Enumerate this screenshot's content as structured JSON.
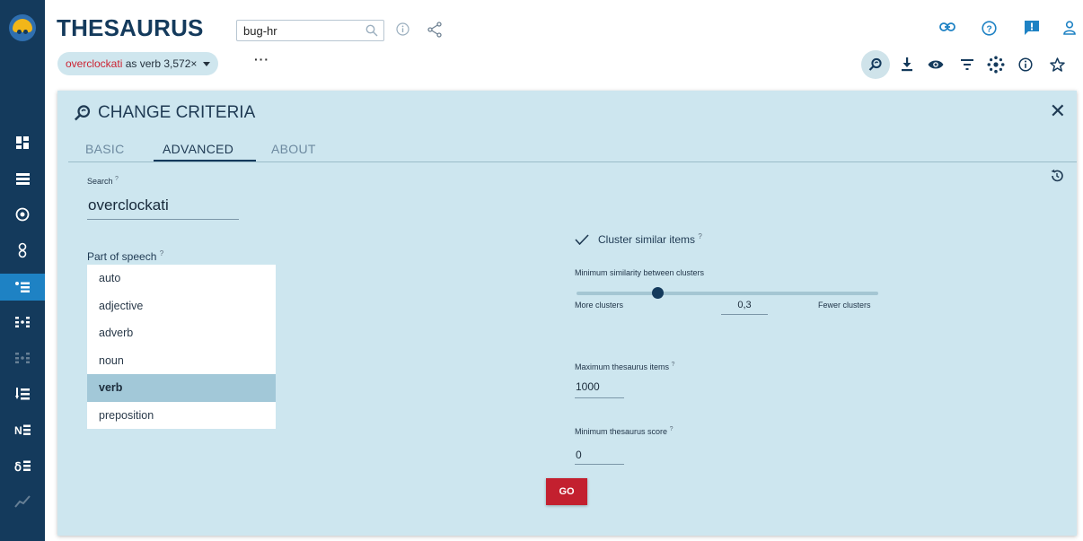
{
  "header": {
    "title": "THESAURUS",
    "corpus": "bug-hr",
    "query_word": "overclockati",
    "query_rest": " as verb 3,572×",
    "more": "···"
  },
  "panel": {
    "title": "CHANGE CRITERIA",
    "tabs": [
      {
        "label": "BASIC"
      },
      {
        "label": "ADVANCED"
      },
      {
        "label": "ABOUT"
      }
    ],
    "active_tab": "ADVANCED",
    "search": {
      "label": "Search",
      "hint": "?",
      "value": "overclockati"
    },
    "part_of_speech": {
      "label": "Part of speech",
      "hint": "?",
      "options": [
        "auto",
        "adjective",
        "adverb",
        "noun",
        "verb",
        "preposition"
      ],
      "selected": "verb"
    },
    "cluster": {
      "label": "Cluster similar items",
      "hint": "?",
      "checked": true
    },
    "similarity": {
      "label": "Minimum similarity between clusters",
      "left_label": "More clusters",
      "right_label": "Fewer clusters",
      "value": "0,3",
      "level": 0.3
    },
    "max_items": {
      "label": "Maximum thesaurus items",
      "hint": "?",
      "value": "1000"
    },
    "min_score": {
      "label": "Minimum thesaurus score",
      "hint": "?",
      "value": "0"
    },
    "go_label": "GO"
  },
  "colors": {
    "sidebar": "#143a5c",
    "sidebar_active": "#1e82c4",
    "panel_bg": "#cde6ef",
    "go_button": "#c3202f",
    "query_word": "#cc2332"
  },
  "icons": {
    "sidebar": [
      "app-logo",
      "dashboard-icon",
      "concordance-icon",
      "word-sketch-icon",
      "sketch-diff-icon",
      "thesaurus-icon",
      "ngrams-icon",
      "keywords-icon",
      "wordlist-icon",
      "n-grams-icon",
      "terms-icon",
      "trends-icon"
    ],
    "header_right": [
      "link-icon",
      "help-icon",
      "feedback-icon",
      "user-icon"
    ],
    "toolbar": [
      "change-criteria-icon",
      "download-icon",
      "view-icon",
      "filter-icon",
      "cluster-icon",
      "info-icon",
      "star-icon"
    ]
  }
}
